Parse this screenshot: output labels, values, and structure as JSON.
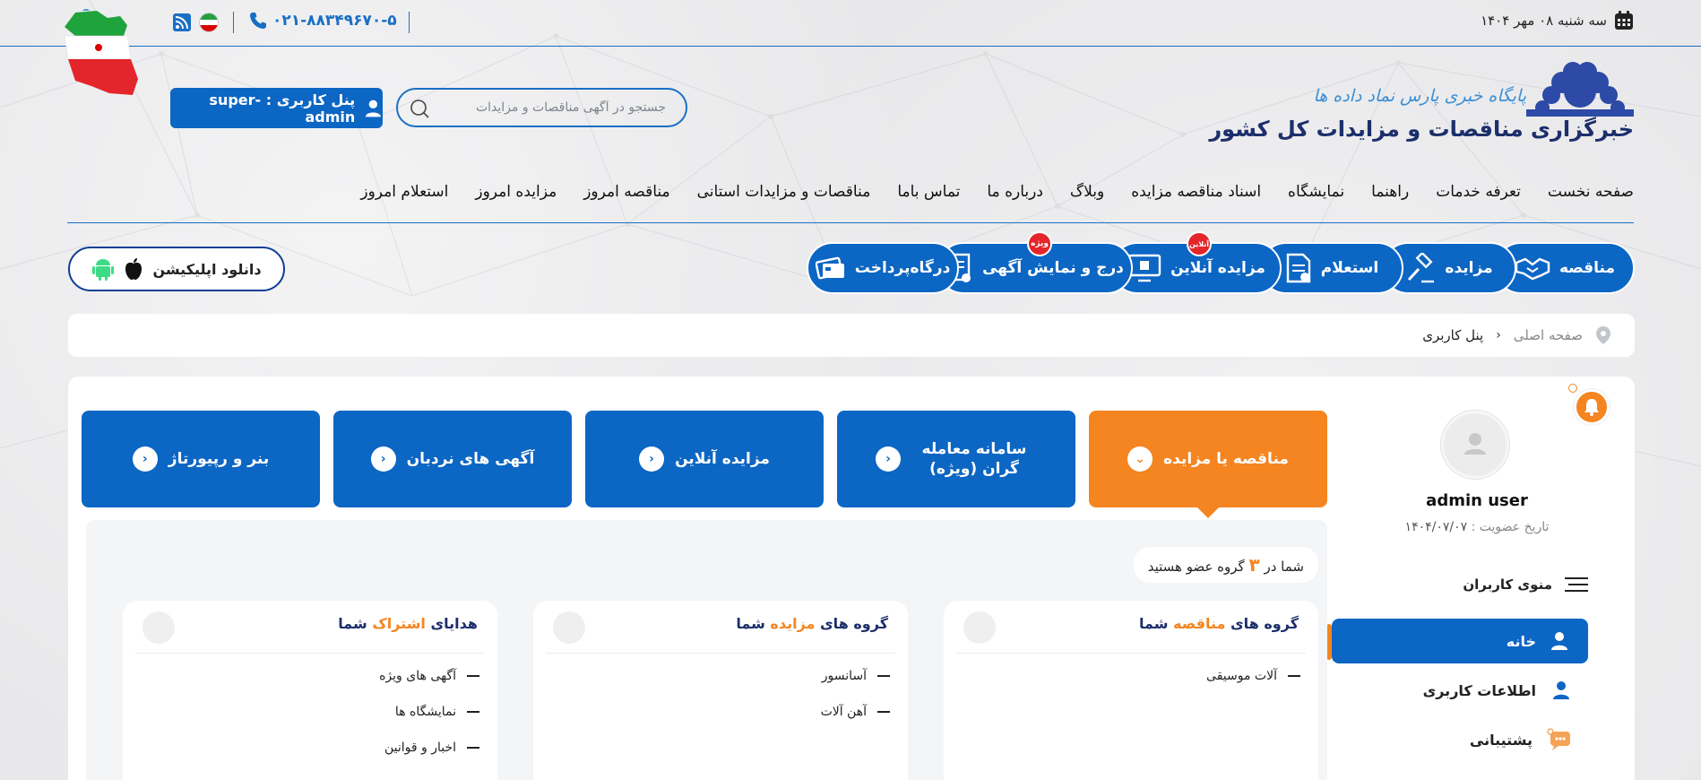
{
  "topbar": {
    "date": "سه شنبه ۰۸ مهر ۱۴۰۴",
    "phone": "۰۲۱-۸۸۳۴۹۶۷۰-۵"
  },
  "logo": {
    "tagline": "پایگاه خبری پارس نماد داده ها",
    "title": "خبرگزاری مناقصات و مزایدات کل کشور"
  },
  "search": {
    "placeholder": "جستجو در آگهی مناقصات و مزایدات"
  },
  "user_panel": {
    "label": "پنل کاربری : super-admin"
  },
  "main_nav": [
    "صفحه نخست",
    "تعرفه خدمات",
    "راهنما",
    "نمایشگاه",
    "اسناد مناقصه مزایده",
    "وبلاگ",
    "درباره ما",
    "تماس باما",
    "مناقصات و مزایدات استانی",
    "مناقصه امروز",
    "مزایده امروز",
    "استعلام امروز"
  ],
  "services": [
    {
      "label": "مناقصه",
      "icon": "handshake-icon",
      "badge": ""
    },
    {
      "label": "مزایده",
      "icon": "gavel-icon",
      "badge": ""
    },
    {
      "label": "استعلام",
      "icon": "document-icon",
      "badge": ""
    },
    {
      "label": "مزایده آنلاین",
      "icon": "monitor-icon",
      "badge": "آنلاین"
    },
    {
      "label": "درج و نمایش آگهی",
      "icon": "scroll-icon",
      "badge": "ویژه"
    },
    {
      "label": "درگاه‌پرداخت",
      "icon": "card-icon",
      "badge": ""
    }
  ],
  "download_app": {
    "label": "دانلود اپلیکیشن"
  },
  "breadcrumb": {
    "home": "صفحه اصلی",
    "current": "پنل کاربری"
  },
  "profile": {
    "name": "admin user",
    "member_since_label": "تاریخ عضویت :",
    "member_since": "۱۴۰۴/۰۷/۰۷"
  },
  "sidebar_menu": {
    "title": "منوی کاربران",
    "items": [
      {
        "label": "خانه",
        "icon": "user-icon",
        "active": true
      },
      {
        "label": "اطلاعات کاربری",
        "icon": "user-info-icon",
        "active": false
      },
      {
        "label": "پشتیبانی",
        "icon": "chat-icon",
        "active": false
      }
    ]
  },
  "tabs": [
    {
      "label": "مناقصه یا مزایده",
      "active": true
    },
    {
      "label": "سامانه معامله گران (ویژه)",
      "active": false
    },
    {
      "label": "مزایده آنلاین",
      "active": false
    },
    {
      "label": "آگهی های نردبان",
      "active": false
    },
    {
      "label": "بنر و رپیورتاژ",
      "active": false
    }
  ],
  "member_count": {
    "prefix": "شما در",
    "count": "۳",
    "suffix": "گروه عضو هستید"
  },
  "groups": [
    {
      "title_pre": "گروه های",
      "title_hl": "مناقصه",
      "title_post": "شما",
      "items": [
        "آلات موسیقی"
      ]
    },
    {
      "title_pre": "گروه های",
      "title_hl": "مزایده",
      "title_post": "شما",
      "items": [
        "آسانسور",
        "آهن آلات"
      ]
    },
    {
      "title_pre": "هدایای",
      "title_hl": "اشتراک",
      "title_post": "شما",
      "items": [
        "آگهی های ویژه",
        "نمایشگاه ها",
        "اخبار و قوانین"
      ]
    }
  ],
  "colors": {
    "primary": "#0c66c4",
    "accent": "#f48520",
    "navy": "#1c2f6b"
  }
}
